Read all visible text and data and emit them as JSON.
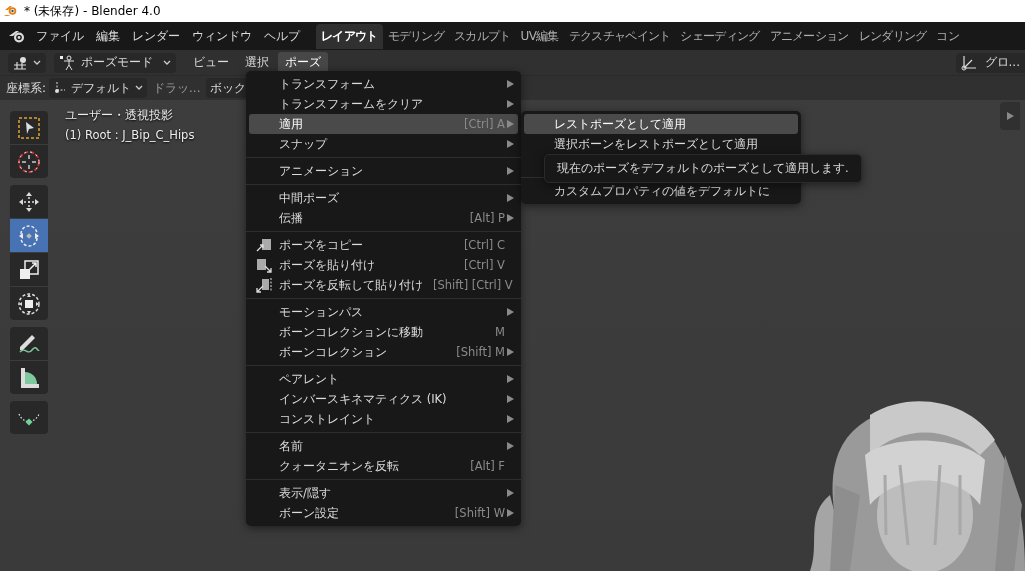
{
  "window": {
    "title": "* (未保存) - Blender 4.0"
  },
  "menubar": {
    "items": [
      "ファイル",
      "編集",
      "レンダー",
      "ウィンドウ",
      "ヘルプ"
    ]
  },
  "workspaces": [
    {
      "label": "レイアウト",
      "selected": true
    },
    {
      "label": "モデリング",
      "selected": false
    },
    {
      "label": "スカルプト",
      "selected": false
    },
    {
      "label": "UV編集",
      "selected": false
    },
    {
      "label": "テクスチャペイント",
      "selected": false
    },
    {
      "label": "シェーディング",
      "selected": false
    },
    {
      "label": "アニメーション",
      "selected": false
    },
    {
      "label": "レンダリング",
      "selected": false
    },
    {
      "label": "コン",
      "selected": false
    }
  ],
  "header": {
    "mode": "ポーズモード",
    "menus": [
      {
        "label": "ビュー",
        "selected": false
      },
      {
        "label": "選択",
        "selected": false
      },
      {
        "label": "ポーズ",
        "selected": true
      }
    ],
    "orientation": "グロ..."
  },
  "tool_settings": {
    "label": "座標系:",
    "pivot": "デフォルト",
    "drag": "ドラッ...",
    "box": "ボック"
  },
  "toolbar": [
    {
      "kind": "select",
      "selected": false
    },
    {
      "kind": "cursor",
      "selected": false
    },
    {
      "kind": "move",
      "selected": false
    },
    {
      "kind": "rotate",
      "selected": true
    },
    {
      "kind": "scale",
      "selected": false
    },
    {
      "kind": "transform",
      "selected": false
    },
    {
      "kind": "annotate",
      "selected": false
    },
    {
      "kind": "measure",
      "selected": false
    },
    {
      "kind": "bone",
      "selected": false
    }
  ],
  "viewport": {
    "view_name": "ユーザー・透視投影",
    "object": "(1) Root : J_Bip_C_Hips"
  },
  "pose_menu": {
    "sections": [
      [
        {
          "label": "トランスフォーム",
          "submenu": true,
          "selected": false
        },
        {
          "label": "トランスフォームをクリア",
          "submenu": true,
          "selected": false
        },
        {
          "label": "適用",
          "shortcut": "[Ctrl] A",
          "submenu": true,
          "selected": true
        },
        {
          "label": "スナップ",
          "submenu": true,
          "selected": false
        }
      ],
      [
        {
          "label": "アニメーション",
          "submenu": true,
          "selected": false
        }
      ],
      [
        {
          "label": "中間ポーズ",
          "submenu": true,
          "selected": false
        },
        {
          "label": "伝播",
          "shortcut": "[Alt] P",
          "submenu": true,
          "selected": false
        }
      ],
      [
        {
          "label": "ポーズをコピー",
          "shortcut": "[Ctrl] C",
          "submenu": false,
          "selected": false
        },
        {
          "label": "ポーズを貼り付け",
          "shortcut": "[Ctrl] V",
          "submenu": false,
          "selected": false
        },
        {
          "label": "ポーズを反転して貼り付け",
          "shortcut": "[Shift] [Ctrl] V",
          "submenu": false,
          "selected": false
        }
      ],
      [
        {
          "label": "モーションパス",
          "submenu": true,
          "selected": false
        },
        {
          "label": "ボーンコレクションに移動",
          "shortcut": "M",
          "submenu": false,
          "selected": false
        },
        {
          "label": "ボーンコレクション",
          "shortcut": "[Shift] M",
          "submenu": true,
          "selected": false
        }
      ],
      [
        {
          "label": "ペアレント",
          "submenu": true,
          "selected": false
        },
        {
          "label": "インバースキネマティクス (IK)",
          "submenu": true,
          "selected": false
        },
        {
          "label": "コンストレイント",
          "submenu": true,
          "selected": false
        }
      ],
      [
        {
          "label": "名前",
          "submenu": true,
          "selected": false
        },
        {
          "label": "クォータニオンを反転",
          "shortcut": "[Alt] F",
          "submenu": false,
          "selected": false
        }
      ],
      [
        {
          "label": "表示/隠す",
          "submenu": true,
          "selected": false
        },
        {
          "label": "ボーン設定",
          "shortcut": "[Shift] W",
          "submenu": true,
          "selected": false
        }
      ]
    ]
  },
  "apply_submenu": {
    "sections": [
      [
        {
          "label": "レストポーズとして適用",
          "submenu": false,
          "selected": true
        },
        {
          "label": "選択ボーンをレストポーズとして適用",
          "submenu": false,
          "selected": false
        }
      ],
      [
        {
          "label": "カスタムプロパティの値をデフォルトに",
          "submenu": false,
          "selected": false
        }
      ]
    ]
  },
  "tooltip": {
    "text": "現在のポーズをデフォルトのポーズとして適用します."
  }
}
